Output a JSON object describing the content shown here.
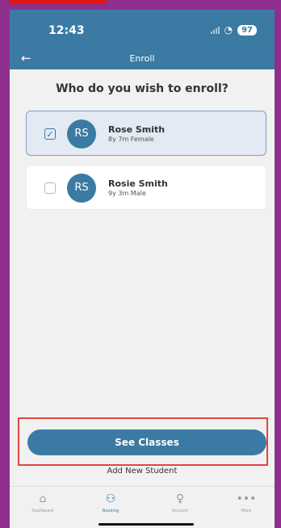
{
  "status_bar": {
    "time": "12:43",
    "battery": "97"
  },
  "nav": {
    "title": "Enroll",
    "back_icon": "arrow-left-icon"
  },
  "prompt": "Who do you wish to enroll?",
  "students": [
    {
      "initials": "RS",
      "name": "Rose Smith",
      "details": "8y 7m Female",
      "selected": true
    },
    {
      "initials": "RS",
      "name": "Rosie Smith",
      "details": "9y 3m Male",
      "selected": false
    }
  ],
  "actions": {
    "primary": "See Classes",
    "secondary": "Add New Student"
  },
  "tabs": [
    {
      "label": "Dashboard",
      "icon": "home-icon"
    },
    {
      "label": "Booking",
      "icon": "people-icon",
      "active": true
    },
    {
      "label": "Account",
      "icon": "person-icon"
    },
    {
      "label": "More",
      "icon": "ellipsis-icon"
    }
  ],
  "colors": {
    "primary": "#3a7aa3",
    "highlight": "#e2453c",
    "frame": "#8e2f8e"
  }
}
